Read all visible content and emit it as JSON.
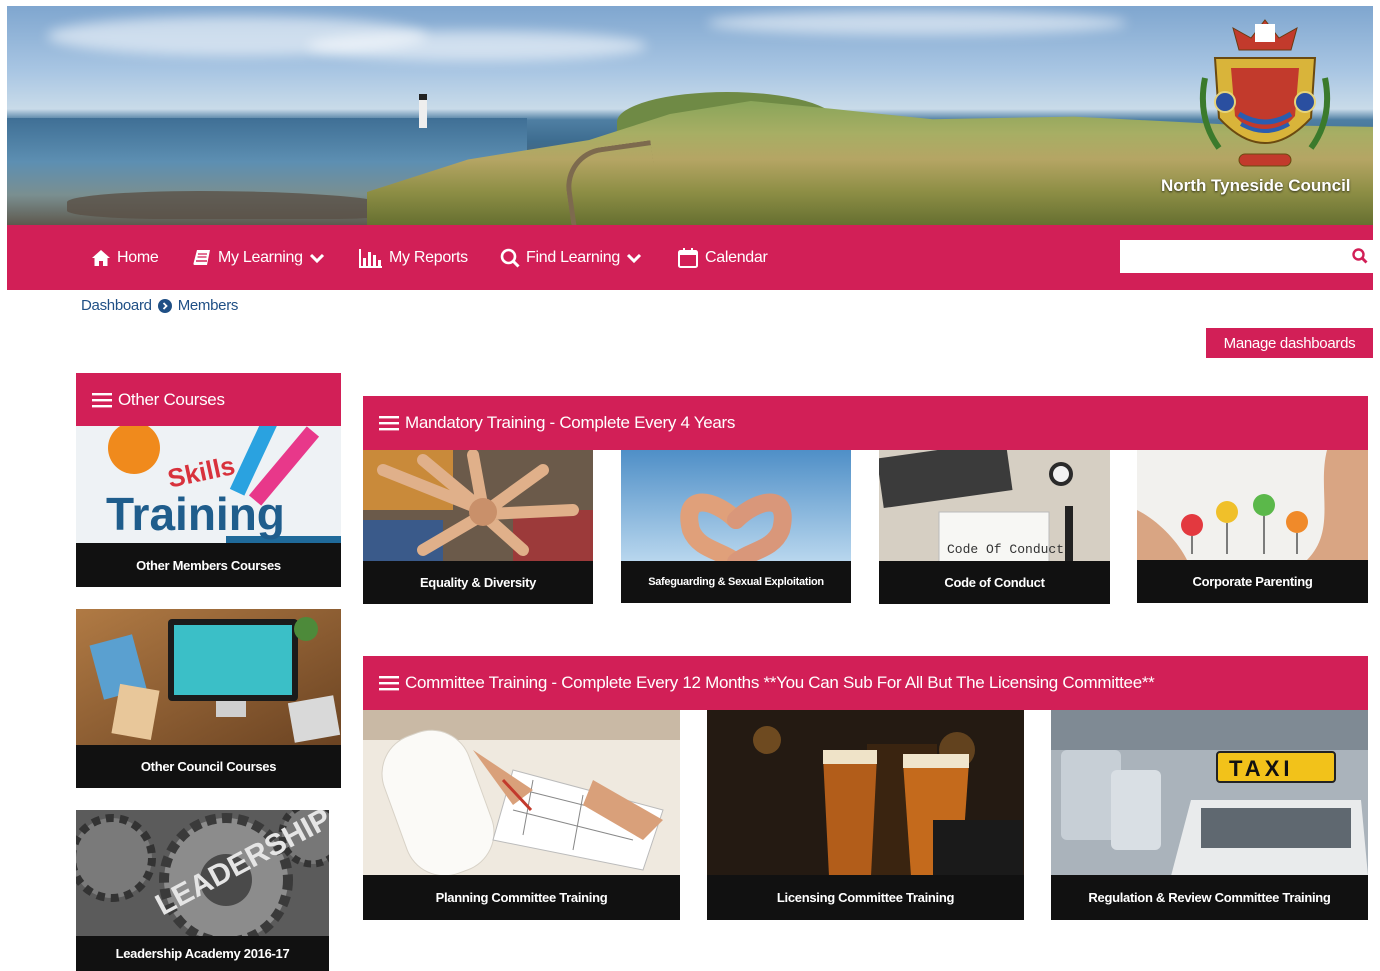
{
  "banner": {
    "council_name": "North Tyneside Council"
  },
  "nav": {
    "items": [
      {
        "label": "Home",
        "icon": "home-icon"
      },
      {
        "label": "My Learning",
        "icon": "book-icon",
        "has_dropdown": true
      },
      {
        "label": "My Reports",
        "icon": "bar-chart-icon"
      },
      {
        "label": "Find Learning",
        "icon": "search-icon",
        "has_dropdown": true
      },
      {
        "label": "Calendar",
        "icon": "calendar-icon"
      }
    ],
    "search": {
      "value": "",
      "placeholder": ""
    }
  },
  "breadcrumb": [
    "Dashboard",
    "Members"
  ],
  "manage_dashboards_label": "Manage dashboards",
  "colors": {
    "accent": "#d21f57",
    "caption_bg": "#111111",
    "link": "#1f4f85"
  },
  "other_courses": {
    "title": "Other Courses",
    "tiles": [
      {
        "caption": "Other Members Courses",
        "image_text": [
          "Skills",
          "Training"
        ]
      },
      {
        "caption": "Other Council Courses"
      },
      {
        "caption": "Leadership Academy 2016-17",
        "image_text": [
          "LEADERSHIP"
        ]
      }
    ]
  },
  "mandatory": {
    "title": "Mandatory Training - Complete Every 4 Years",
    "tiles": [
      {
        "caption": "Equality & Diversity"
      },
      {
        "caption": "Safeguarding & Sexual Exploitation"
      },
      {
        "caption": "Code of Conduct",
        "image_text": [
          "Code Of Conduct"
        ]
      },
      {
        "caption": "Corporate Parenting"
      }
    ]
  },
  "committee": {
    "title": "Committee Training - Complete Every 12 Months **You Can Sub For All But The Licensing Committee**",
    "tiles": [
      {
        "caption": "Planning Committee Training"
      },
      {
        "caption": "Licensing Committee Training"
      },
      {
        "caption": "Regulation & Review Committee Training",
        "image_text": [
          "TAXI"
        ]
      }
    ]
  }
}
